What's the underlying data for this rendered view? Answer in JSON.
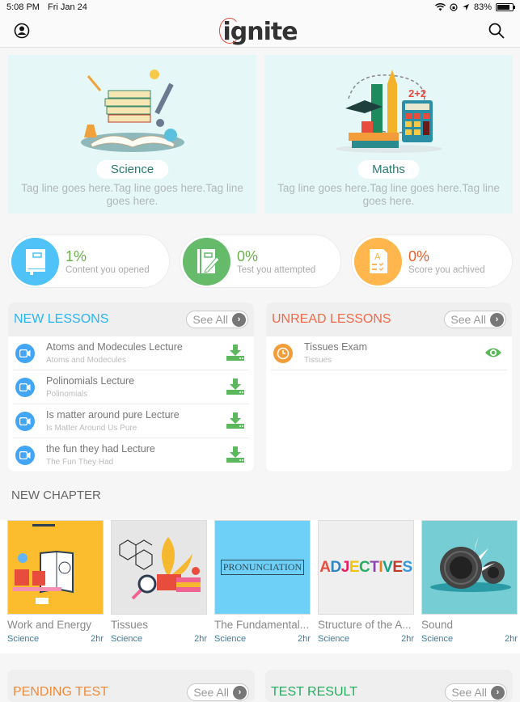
{
  "status_bar": {
    "time": "5:08 PM",
    "date": "Fri Jan 24",
    "battery": "83%",
    "battery_level": 0.83
  },
  "header": {
    "logo": "ignite",
    "profile_icon": "profile-icon",
    "search_icon": "search-icon"
  },
  "subjects": [
    {
      "name": "Science",
      "tagline": "Tag line goes here.Tag line goes here.Tag line goes here."
    },
    {
      "name": "Maths",
      "tagline": "Tag line goes here.Tag line goes here.Tag line goes here."
    }
  ],
  "stats": [
    {
      "value": "1%",
      "label": "Content you opened",
      "color": "#6ab04c",
      "icon_bg": "#4fc3f7",
      "icon": "book-icon"
    },
    {
      "value": "0%",
      "label": "Test you attempted",
      "color": "#6ab04c",
      "icon_bg": "#66bb6a",
      "icon": "notebook-pencil-icon"
    },
    {
      "value": "0%",
      "label": "Score you achived",
      "color": "#e8612c",
      "icon_bg": "#ffb74d",
      "icon": "graded-paper-icon"
    }
  ],
  "new_lessons": {
    "title": "NEW LESSONS",
    "title_color": "#29b6f6",
    "see_all": "See All",
    "items": [
      {
        "title": "Atoms and Modecules Lecture",
        "subtitle": "Atoms and Modecules"
      },
      {
        "title": "Polinomials Lecture",
        "subtitle": "Polinomials"
      },
      {
        "title": "Is matter around pure Lecture",
        "subtitle": "Is Matter Around Us Pure"
      },
      {
        "title": "the fun they had Lecture",
        "subtitle": "The Fun They Had"
      }
    ]
  },
  "unread_lessons": {
    "title": "UNREAD LESSONS",
    "title_color": "#f26b4a",
    "see_all": "See All",
    "items": [
      {
        "title": "Tissues Exam",
        "subtitle": "Tissues"
      }
    ]
  },
  "new_chapter": {
    "title": "NEW CHAPTER",
    "items": [
      {
        "name": "Work and Energy",
        "subject": "Science",
        "duration": "2hr"
      },
      {
        "name": "Tissues",
        "subject": "Science",
        "duration": "2hr"
      },
      {
        "name": "The Fundamental...",
        "subject": "Science",
        "duration": "2hr",
        "image_text": "PRONUNCIATION"
      },
      {
        "name": "Structure of the A...",
        "subject": "Science",
        "duration": "2hr",
        "image_text": "ADJECTIVES"
      },
      {
        "name": "Sound",
        "subject": "Science",
        "duration": "2hr"
      }
    ]
  },
  "pending_test": {
    "title": "PENDING TEST",
    "title_color": "#ef8a3a",
    "see_all": "See All"
  },
  "test_result": {
    "title": "TEST RESULT",
    "title_color": "#27ae60",
    "see_all": "See All"
  }
}
